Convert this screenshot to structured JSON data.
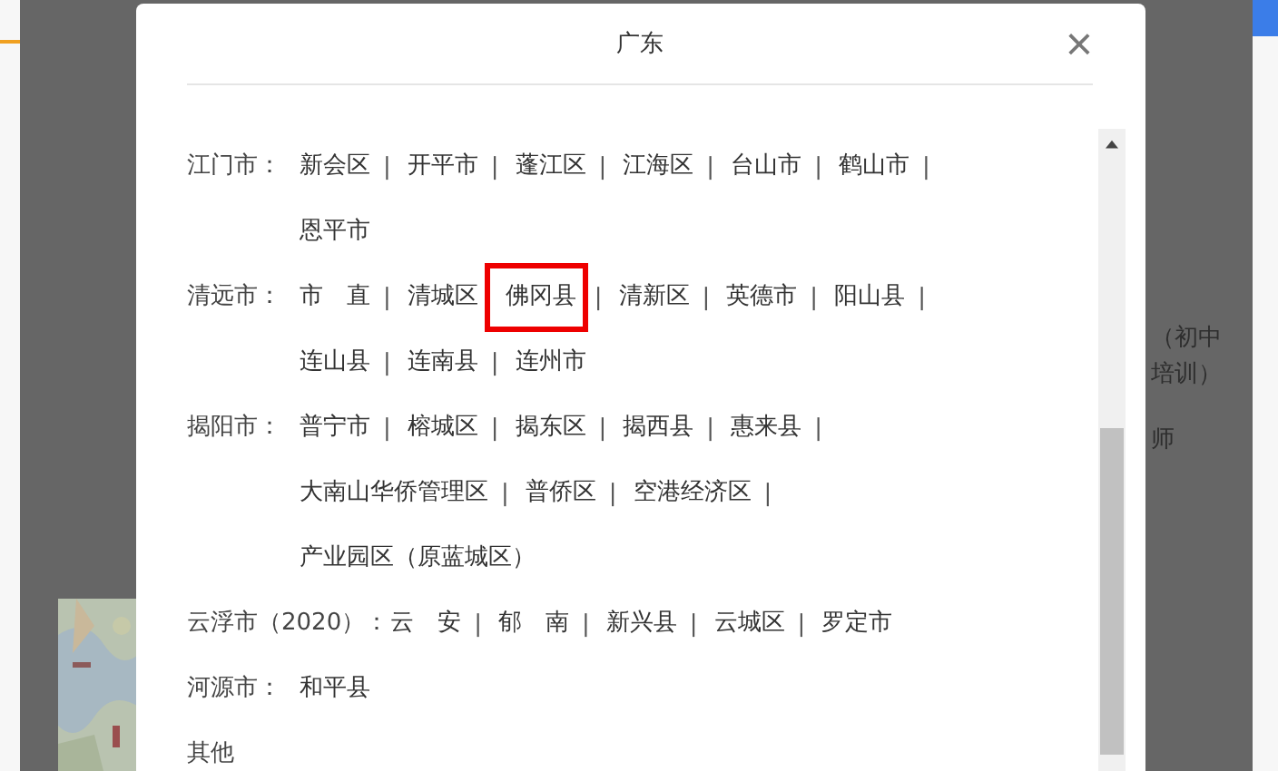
{
  "background": {
    "texts": [
      "（初中",
      "培训）",
      "师"
    ]
  },
  "dialog": {
    "title": "广东",
    "close": "×",
    "cities": [
      {
        "label": "江门市：",
        "lines": [
          [
            {
              "name": "新会区",
              "sep": "|",
              "highlighted": false
            },
            {
              "name": "开平市",
              "sep": "|",
              "highlighted": false
            },
            {
              "name": "蓬江区",
              "sep": "|",
              "highlighted": false
            },
            {
              "name": "江海区",
              "sep": "|",
              "highlighted": false
            },
            {
              "name": "台山市",
              "sep": "|",
              "highlighted": false
            },
            {
              "name": "鹤山市",
              "sep": "|",
              "highlighted": false
            }
          ],
          [
            {
              "name": "恩平市",
              "highlighted": false
            }
          ]
        ]
      },
      {
        "label": "清远市：",
        "lines": [
          [
            {
              "name": "市　直",
              "sep": "|",
              "highlighted": false
            },
            {
              "name": "清城区",
              "highlighted": false
            },
            {
              "name": "佛冈县",
              "sep": "|",
              "highlighted": true
            },
            {
              "name": "清新区",
              "sep": "|",
              "highlighted": false
            },
            {
              "name": "英德市",
              "sep": "|",
              "highlighted": false
            },
            {
              "name": "阳山县",
              "sep": "|",
              "highlighted": false
            }
          ],
          [
            {
              "name": "连山县",
              "sep": "|",
              "highlighted": false
            },
            {
              "name": "连南县",
              "sep": "|",
              "highlighted": false
            },
            {
              "name": "连州市",
              "highlighted": false
            }
          ]
        ]
      },
      {
        "label": "揭阳市：",
        "lines": [
          [
            {
              "name": "普宁市",
              "sep": "|",
              "highlighted": false
            },
            {
              "name": "榕城区",
              "sep": "|",
              "highlighted": false
            },
            {
              "name": "揭东区",
              "sep": "|",
              "highlighted": false
            },
            {
              "name": "揭西县",
              "sep": "|",
              "highlighted": false
            },
            {
              "name": "惠来县",
              "sep": "|",
              "highlighted": false
            }
          ],
          [
            {
              "name": "大南山华侨管理区",
              "sep": "|",
              "highlighted": false
            },
            {
              "name": "普侨区",
              "sep": "|",
              "highlighted": false
            },
            {
              "name": "空港经济区",
              "sep": "|",
              "highlighted": false
            }
          ],
          [
            {
              "name": "产业园区（原蓝城区）",
              "highlighted": false
            }
          ]
        ]
      },
      {
        "label": "云浮市（2020）：",
        "lines": [
          [
            {
              "name": "云　安",
              "sep": "|",
              "highlighted": false
            },
            {
              "name": "郁　南",
              "sep": "|",
              "highlighted": false
            },
            {
              "name": "新兴县",
              "sep": "|",
              "highlighted": false
            },
            {
              "name": "云城区",
              "sep": "|",
              "highlighted": false
            },
            {
              "name": "罗定市",
              "highlighted": false
            }
          ]
        ]
      },
      {
        "label": "河源市：",
        "lines": [
          [
            {
              "name": "和平县",
              "highlighted": false
            }
          ]
        ]
      },
      {
        "label": "其他"
      }
    ]
  }
}
